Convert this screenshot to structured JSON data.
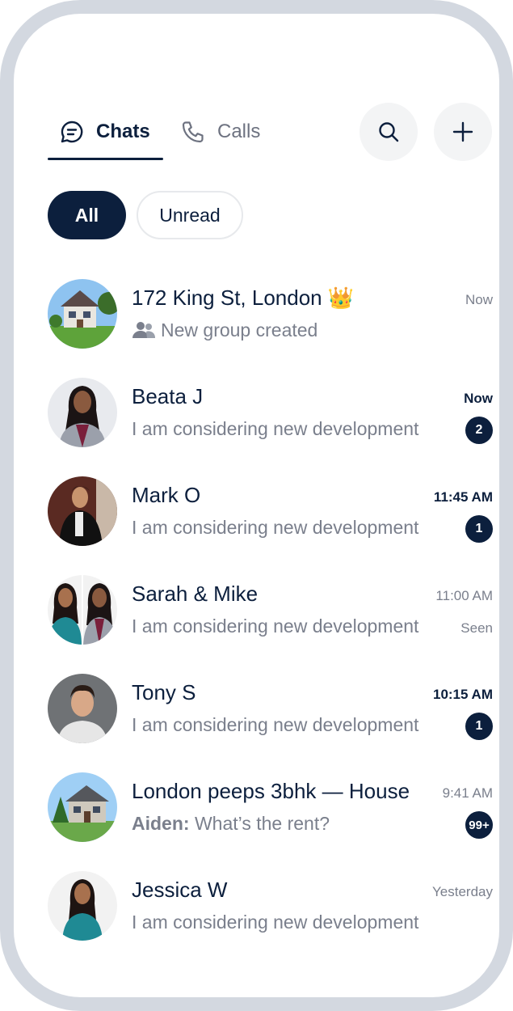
{
  "tabs": {
    "chats": "Chats",
    "calls": "Calls"
  },
  "filters": {
    "all": "All",
    "unread": "Unread"
  },
  "colors": {
    "primary": "#0c1f3d",
    "muted": "#7a7f8c",
    "frame": "#d3d8e0"
  },
  "chats": [
    {
      "name": "172 King St, London",
      "name_emoji": "👑",
      "preview": "New group created",
      "preview_icon": "group-icon",
      "time": "Now",
      "time_bold": false
    },
    {
      "name": "Beata J",
      "preview": "I am considering new development",
      "time": "Now",
      "time_bold": true,
      "badge": "2"
    },
    {
      "name": "Mark O",
      "preview": "I am considering new development",
      "time": "11:45 AM",
      "time_bold": true,
      "badge": "1"
    },
    {
      "name": "Sarah & Mike",
      "preview": "I am considering new development",
      "time": "11:00 AM",
      "time_bold": false,
      "status": "Seen"
    },
    {
      "name": "Tony S",
      "preview": "I am considering new development",
      "time": "10:15 AM",
      "time_bold": true,
      "badge": "1"
    },
    {
      "name": "London peeps 3bhk — House",
      "preview_sender": "Aiden:",
      "preview": "What’s the rent?",
      "time": "9:41 AM",
      "time_bold": false,
      "badge": "99+"
    },
    {
      "name": "Jessica W",
      "preview": "I am considering new development",
      "time": "Yesterday",
      "time_bold": false
    }
  ]
}
